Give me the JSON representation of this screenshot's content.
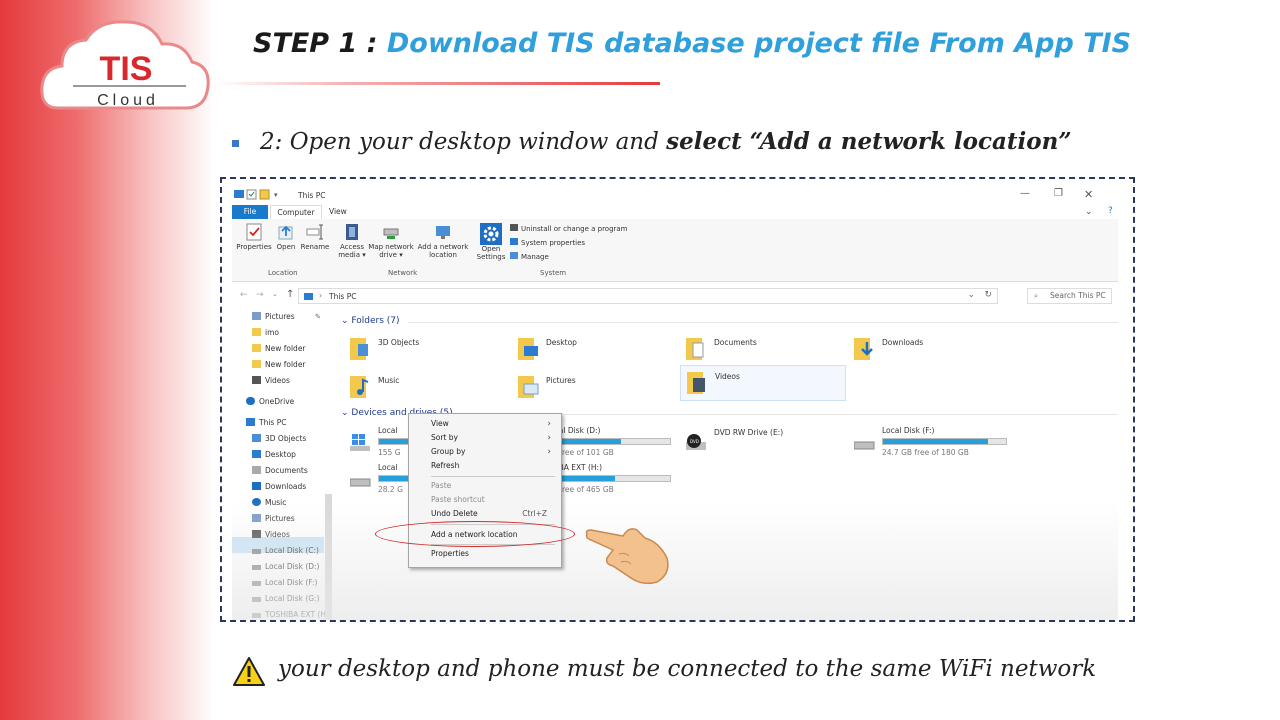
{
  "logo": {
    "brand": "TIS",
    "sub": "Cloud"
  },
  "slide": {
    "step": "STEP 1 : ",
    "title": "Download TIS database project file From App TIS",
    "bullet_text": "2: Open your desktop window and ",
    "bullet_bold": "select “Add a network location”",
    "warning": "your desktop and phone must be connected to the same WiFi network"
  },
  "explorer": {
    "title": "This PC",
    "tabs": {
      "file": "File",
      "computer": "Computer",
      "view": "View"
    },
    "ribbon": {
      "properties": "Properties",
      "open": "Open",
      "rename": "Rename",
      "access_media": "Access media ▾",
      "map_drive": "Map network drive ▾",
      "add_network": "Add a network location",
      "open_settings": "Open Settings",
      "uninstall": "Uninstall or change a program",
      "sys_props": "System properties",
      "manage": "Manage",
      "group_location": "Location",
      "group_network": "Network",
      "group_system": "System"
    },
    "address": "This PC",
    "search_placeholder": "Search This PC",
    "nav": [
      "Pictures",
      "imo",
      "New folder",
      "New folder",
      "Videos",
      "OneDrive",
      "This PC",
      "3D Objects",
      "Desktop",
      "Documents",
      "Downloads",
      "Music",
      "Pictures",
      "Videos",
      "Local Disk (C:)",
      "Local Disk (D:)",
      "Local Disk (F:)",
      "Local Disk (G:)",
      "TOSHIBA EXT (H"
    ],
    "folders_header": "Folders (7)",
    "folders": [
      "3D Objects",
      "Desktop",
      "Documents",
      "Downloads",
      "Music",
      "Pictures",
      "Videos"
    ],
    "devices_header": "Devices and drives (5)",
    "drives": [
      {
        "name": "Local",
        "space": "155 G",
        "fill": 0.3
      },
      {
        "name": "Local Disk (D:)",
        "space": "GB free of 101 GB",
        "fill": 0.6
      },
      {
        "name": "DVD RW Drive (E:)",
        "space": "",
        "fill": 0
      },
      {
        "name": "Local Disk (F:)",
        "space": "24.7 GB free of 180 GB",
        "fill": 0.85
      },
      {
        "name": "Local",
        "space": "28.2 G",
        "fill": 0.5
      },
      {
        "name": "SHIBA EXT (H:)",
        "space": "GB free of 465 GB",
        "fill": 0.55
      }
    ],
    "context_menu": {
      "view": "View",
      "sort_by": "Sort by",
      "group_by": "Group by",
      "refresh": "Refresh",
      "paste": "Paste",
      "paste_shortcut": "Paste shortcut",
      "undo_delete": "Undo Delete",
      "undo_shortcut": "Ctrl+Z",
      "add_network": "Add a network location",
      "properties": "Properties"
    }
  },
  "colors": {
    "accent_red": "#e53a3d",
    "title_blue": "#2fa0dc",
    "win_blue": "#1979ca"
  }
}
